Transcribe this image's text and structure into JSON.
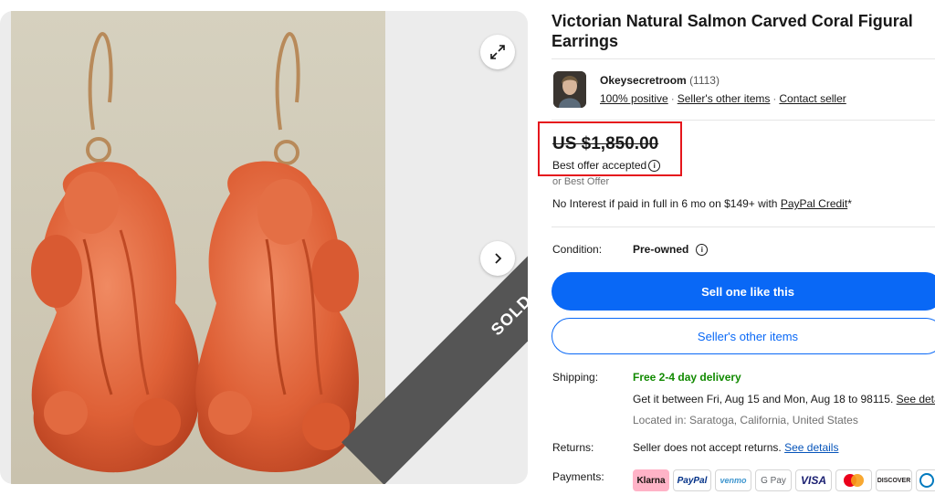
{
  "gallery": {
    "sold_ribbon": "SOLD",
    "expand_icon": "expand-icon",
    "next_icon": "chevron-right-icon"
  },
  "listing": {
    "title": "Victorian Natural Salmon Carved Coral Figural Earrings"
  },
  "seller": {
    "name": "Okeysecretroom",
    "feedback_count": "(1113)",
    "positive": "100% positive",
    "other_items": "Seller's other items",
    "contact": "Contact seller"
  },
  "price": {
    "amount": "US $1,850.00",
    "status": "Best offer accepted",
    "or_best_offer": "or Best Offer",
    "credit_text": "No Interest if paid in full in 6 mo on $149+ with ",
    "credit_link": "PayPal Credit",
    "credit_suffix": "*"
  },
  "condition": {
    "label": "Condition:",
    "value": "Pre-owned"
  },
  "actions": {
    "primary": "Sell one like this",
    "secondary": "Seller's other items"
  },
  "shipping": {
    "label": "Shipping:",
    "free": "Free 2-4 day delivery",
    "between": "Get it between Fri, Aug 15 and Mon, Aug 18 to 98115. ",
    "details_link": "See details",
    "located": "Located in: Saratoga, California, United States"
  },
  "returns": {
    "label": "Returns:",
    "text": "Seller does not accept returns. ",
    "link": "See details"
  },
  "payments": {
    "label": "Payments:",
    "methods": [
      "Klarna",
      "PayPal",
      "venmo",
      "G Pay",
      "VISA",
      "Mastercard",
      "DISCOVER",
      "Diners"
    ]
  },
  "colors": {
    "accent": "#0968f6",
    "highlight_box": "#e5161c",
    "free_delivery": "#118a00",
    "coral": "#e0643d"
  }
}
